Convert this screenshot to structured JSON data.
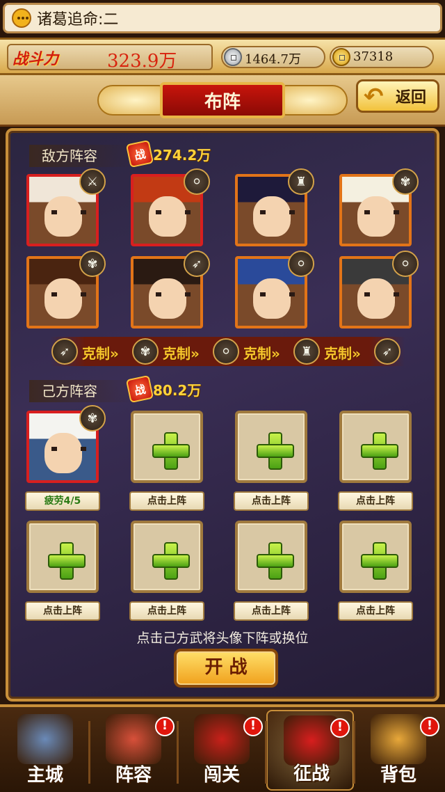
{
  "message": {
    "text": "诸葛追命:二",
    "icon": "chat-bubble-icon"
  },
  "stats": {
    "power_label": "战斗力",
    "power_value": "323.9万",
    "silver": "1464.7万",
    "gold": "37318"
  },
  "header": {
    "title": "布阵",
    "back_label": "返回"
  },
  "enemy": {
    "title": "敌方阵容",
    "power_badge": "战",
    "power": "274.2万",
    "heroes": [
      {
        "face": "#f1c9b4",
        "hair": "#f0e6d8",
        "frame": "red",
        "type": "dagger-icon",
        "glyph": "⚔"
      },
      {
        "face": "#e8b48a",
        "hair": "#c23a14",
        "frame": "red",
        "type": "spear-icon",
        "glyph": "⚪"
      },
      {
        "face": "#f2d2b4",
        "hair": "#1e1a3a",
        "frame": "orange",
        "type": "armor-icon",
        "glyph": "♜"
      },
      {
        "face": "#f2d8bc",
        "hair": "#f4f0e0",
        "frame": "orange",
        "type": "fan-icon",
        "glyph": "✾"
      },
      {
        "face": "#e8c4a0",
        "hair": "#4a2410",
        "frame": "orange",
        "type": "fan-icon",
        "glyph": "✾"
      },
      {
        "face": "#e0b68c",
        "hair": "#2a1a12",
        "frame": "orange",
        "type": "bow-icon",
        "glyph": "➶"
      },
      {
        "face": "#f2d6b8",
        "hair": "#2a4a9a",
        "frame": "orange",
        "type": "spear-icon",
        "glyph": "⚪"
      },
      {
        "face": "#e0b890",
        "hair": "#3a3a3a",
        "frame": "orange",
        "type": "spear-icon",
        "glyph": "⚪"
      }
    ]
  },
  "restraint": {
    "label": "克制",
    "chain": [
      {
        "type": "bow-icon",
        "glyph": "➶"
      },
      {
        "type": "fan-icon",
        "glyph": "✾"
      },
      {
        "type": "spear-icon",
        "glyph": "⚪"
      },
      {
        "type": "armor-icon",
        "glyph": "♜"
      },
      {
        "type": "bow-icon",
        "glyph": "➶"
      }
    ]
  },
  "ally": {
    "title": "己方阵容",
    "power_badge": "战",
    "power": "80.2万",
    "hero": {
      "face": "#f2d6c0",
      "hair": "#f4f4f0",
      "type": "fan-icon",
      "glyph": "✾",
      "status": "疲劳4/5"
    },
    "empty_label": "点击上阵"
  },
  "hint": "点击己方武将头像下阵或换位",
  "start_label": "开 战",
  "nav": [
    {
      "label": "主城",
      "icon": "castle-icon",
      "color": "#6a8ab8",
      "notice": false,
      "active": false
    },
    {
      "label": "阵容",
      "icon": "generals-icon",
      "color": "#d8503a",
      "notice": true,
      "active": false
    },
    {
      "label": "闯关",
      "icon": "banner-icon",
      "color": "#c8201a",
      "notice": true,
      "active": false
    },
    {
      "label": "征战",
      "icon": "crossed-swords-icon",
      "color": "#d81e1e",
      "notice": true,
      "active": true
    },
    {
      "label": "背包",
      "icon": "bag-icon",
      "color": "#e8a83a",
      "notice": true,
      "active": false
    }
  ],
  "notice_glyph": "!"
}
